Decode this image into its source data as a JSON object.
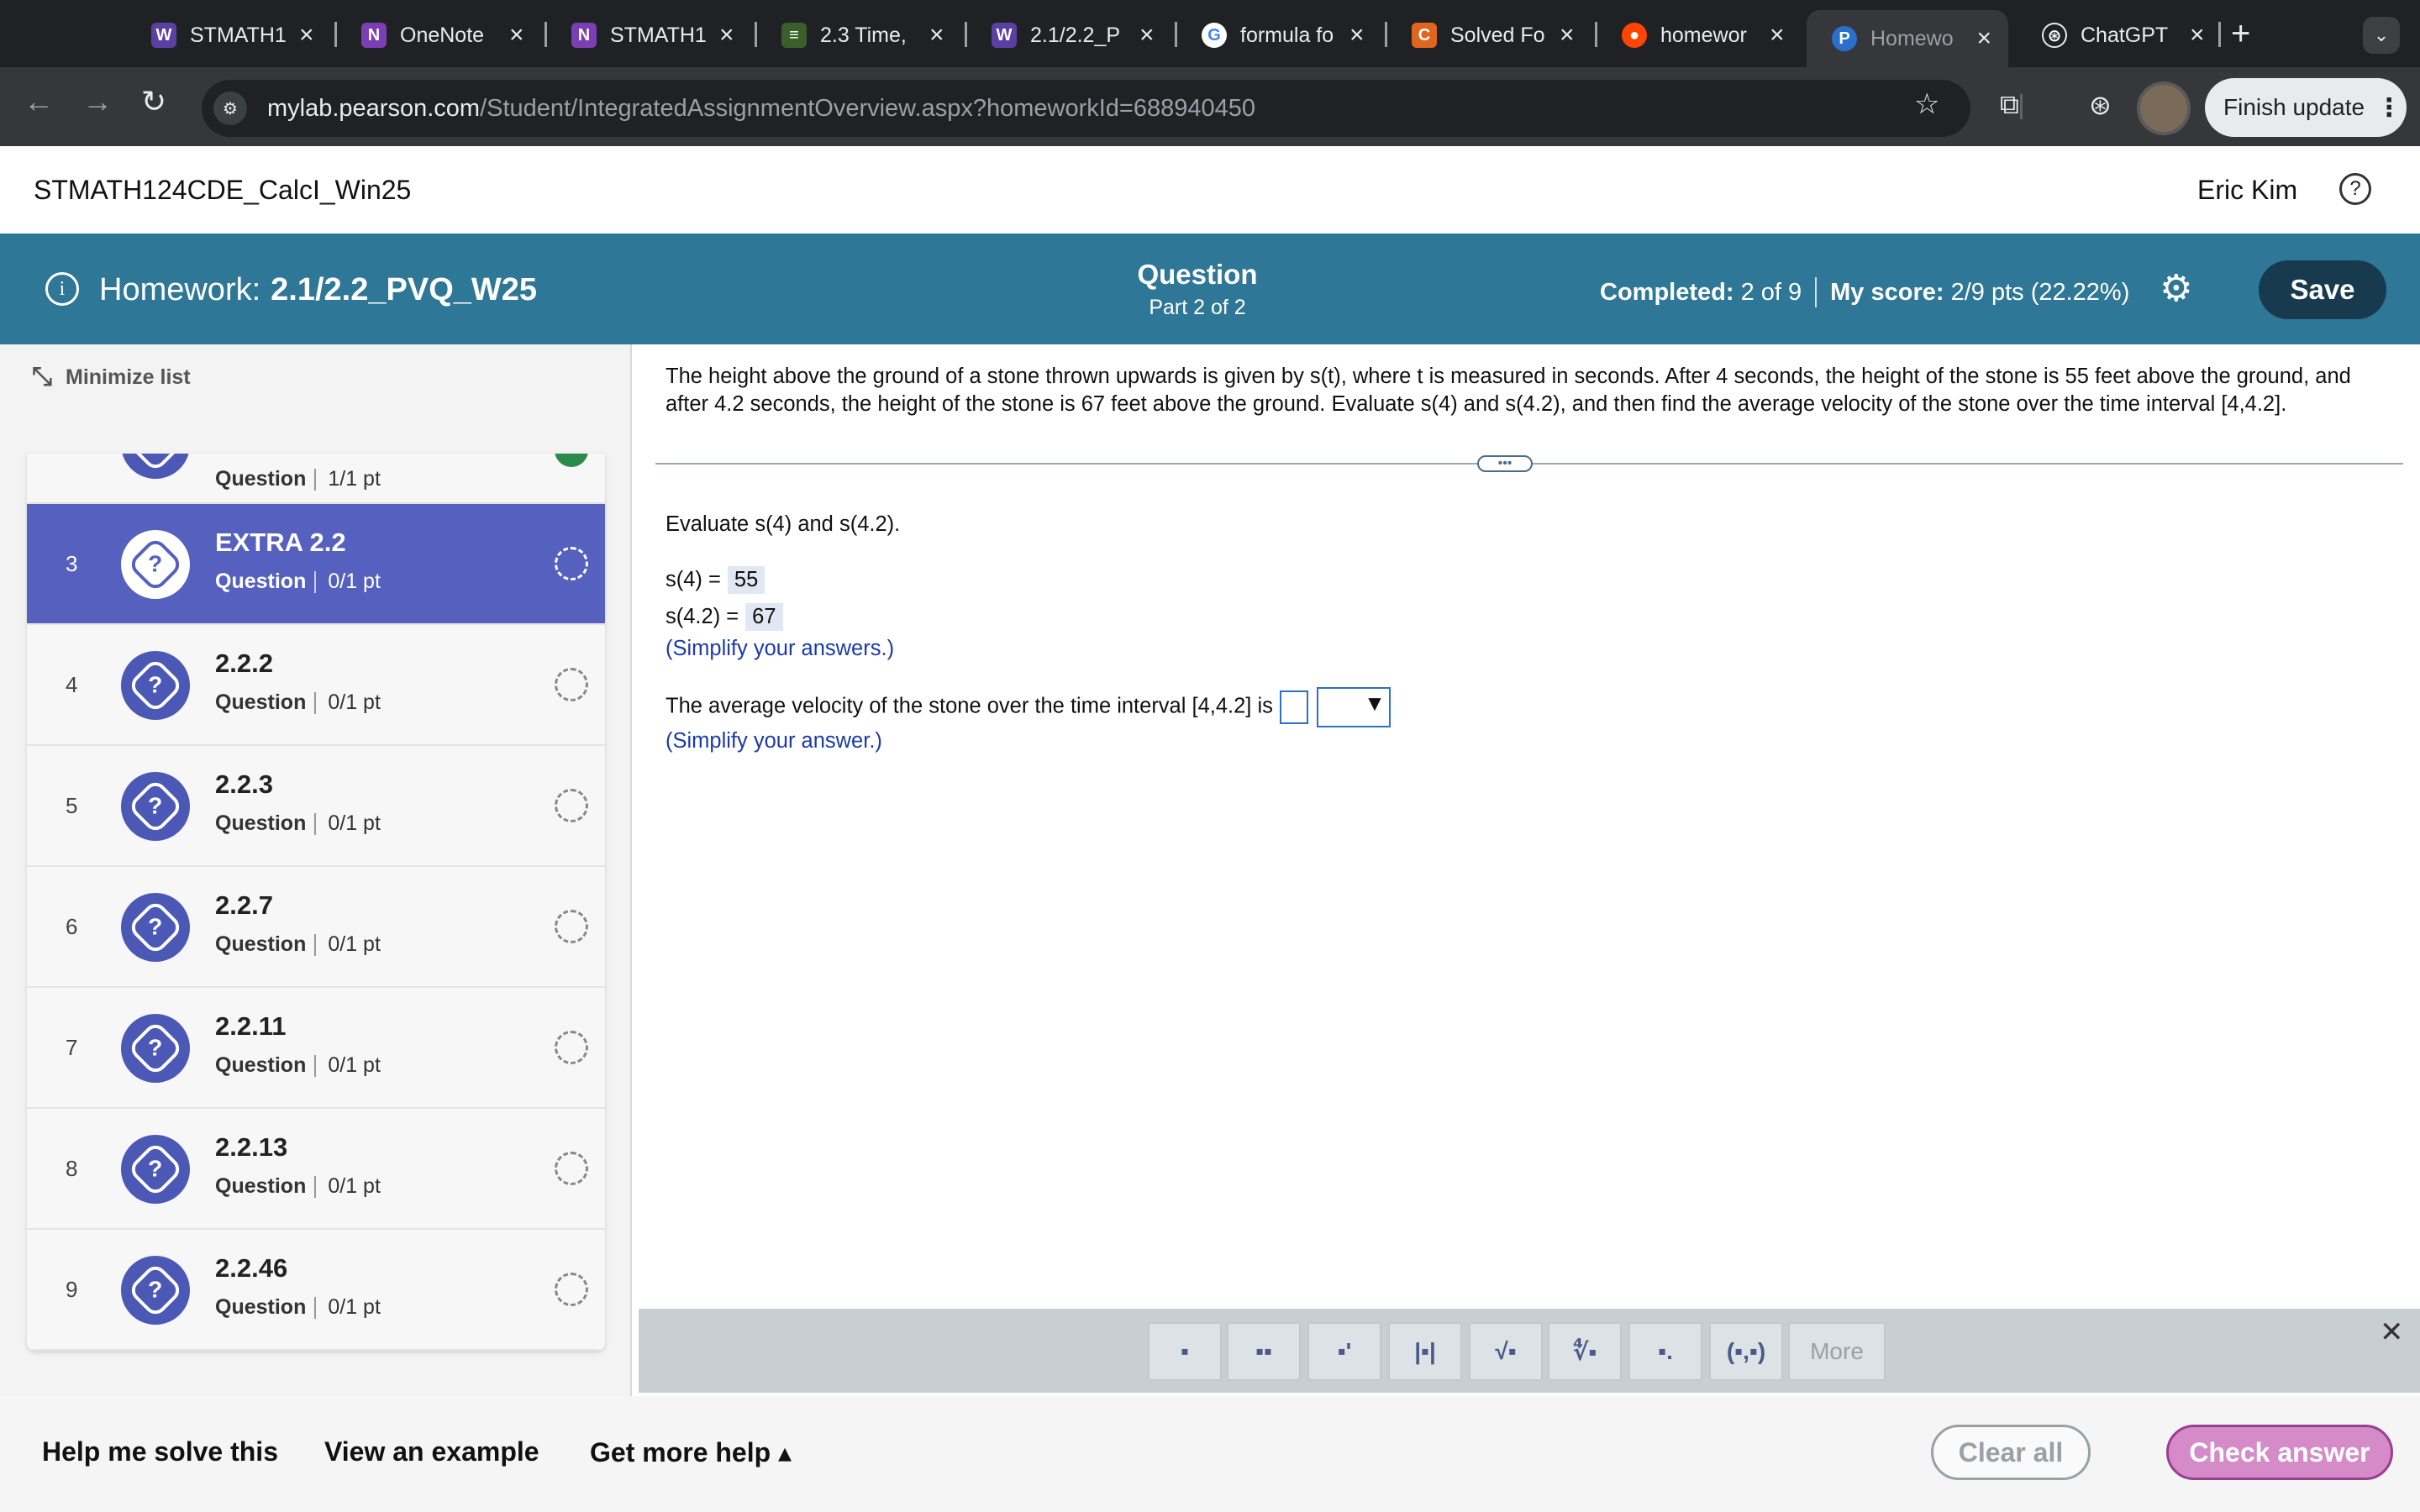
{
  "browser": {
    "tabs": [
      {
        "label": "STMATH1",
        "icon": "W",
        "color": "#5b3fa3"
      },
      {
        "label": "OneNote",
        "icon": "N",
        "color": "#7b3fb5"
      },
      {
        "label": "STMATH1",
        "icon": "N",
        "color": "#7b3fb5"
      },
      {
        "label": "2.3 Time,",
        "icon": "≡",
        "color": "#3a5f2a"
      },
      {
        "label": "2.1/2.2_P",
        "icon": "W",
        "color": "#5b3fa3"
      },
      {
        "label": "formula fo",
        "icon": "G",
        "color": "#ffffff"
      },
      {
        "label": "Solved Fo",
        "icon": "C",
        "color": "#e0651f"
      },
      {
        "label": "homewor",
        "icon": "●",
        "color": "#ff4500"
      },
      {
        "label": "Homewo",
        "icon": "P",
        "color": "#2a6fc9"
      },
      {
        "label": "ChatGPT",
        "icon": "⊛",
        "color": "#202124"
      }
    ],
    "url_host": "mylab.pearson.com",
    "url_path": "/Student/IntegratedAssignmentOverview.aspx?homeworkId=688940450",
    "update_label": "Finish update"
  },
  "header": {
    "course": "STMATH124CDE_CalcI_Win25",
    "user": "Eric Kim"
  },
  "hwbar": {
    "label": "Homework:",
    "name": "2.1/2.2_PVQ_W25",
    "question_title": "Question",
    "question_part": "Part 2 of 2",
    "completed_label": "Completed:",
    "completed_value": "2 of 9",
    "score_label": "My score:",
    "score_value": "2/9 pts (22.22%)",
    "save_label": "Save"
  },
  "sidebar": {
    "minimize_label": "Minimize list",
    "items": [
      {
        "num": "",
        "name": "",
        "type": "Question",
        "pts": "1/1 pt",
        "status": "done"
      },
      {
        "num": "3",
        "name": "EXTRA 2.2",
        "type": "Question",
        "pts": "0/1 pt",
        "status": "open"
      },
      {
        "num": "4",
        "name": "2.2.2",
        "type": "Question",
        "pts": "0/1 pt",
        "status": "open"
      },
      {
        "num": "5",
        "name": "2.2.3",
        "type": "Question",
        "pts": "0/1 pt",
        "status": "open"
      },
      {
        "num": "6",
        "name": "2.2.7",
        "type": "Question",
        "pts": "0/1 pt",
        "status": "open"
      },
      {
        "num": "7",
        "name": "2.2.11",
        "type": "Question",
        "pts": "0/1 pt",
        "status": "open"
      },
      {
        "num": "8",
        "name": "2.2.13",
        "type": "Question",
        "pts": "0/1 pt",
        "status": "open"
      },
      {
        "num": "9",
        "name": "2.2.46",
        "type": "Question",
        "pts": "0/1 pt",
        "status": "open"
      }
    ]
  },
  "question": {
    "prompt": "The height above the ground of a stone thrown upwards is given by s(t), where t is measured in seconds. After 4 seconds, the height of the stone is 55 feet above the ground, and after 4.2 seconds, the height of the stone is 67 feet above the ground. Evaluate s(4) and s(4.2), and then find the average velocity of the stone over the time interval [4,4.2].",
    "part1_heading": "Evaluate s(4) and s(4.2).",
    "s4_label": "s(4) =",
    "s4_value": "55",
    "s42_label": "s(4.2) =",
    "s42_value": "67",
    "hint1": "(Simplify your answers.)",
    "part2_text": "The average velocity of the stone over the time interval [4,4.2] is",
    "hint2": "(Simplify your answer.)"
  },
  "palette": {
    "more_label": "More"
  },
  "footer": {
    "help_solve": "Help me solve this",
    "view_example": "View an example",
    "more_help": "Get more help ▴",
    "clear_all": "Clear all",
    "check_answer": "Check answer"
  }
}
